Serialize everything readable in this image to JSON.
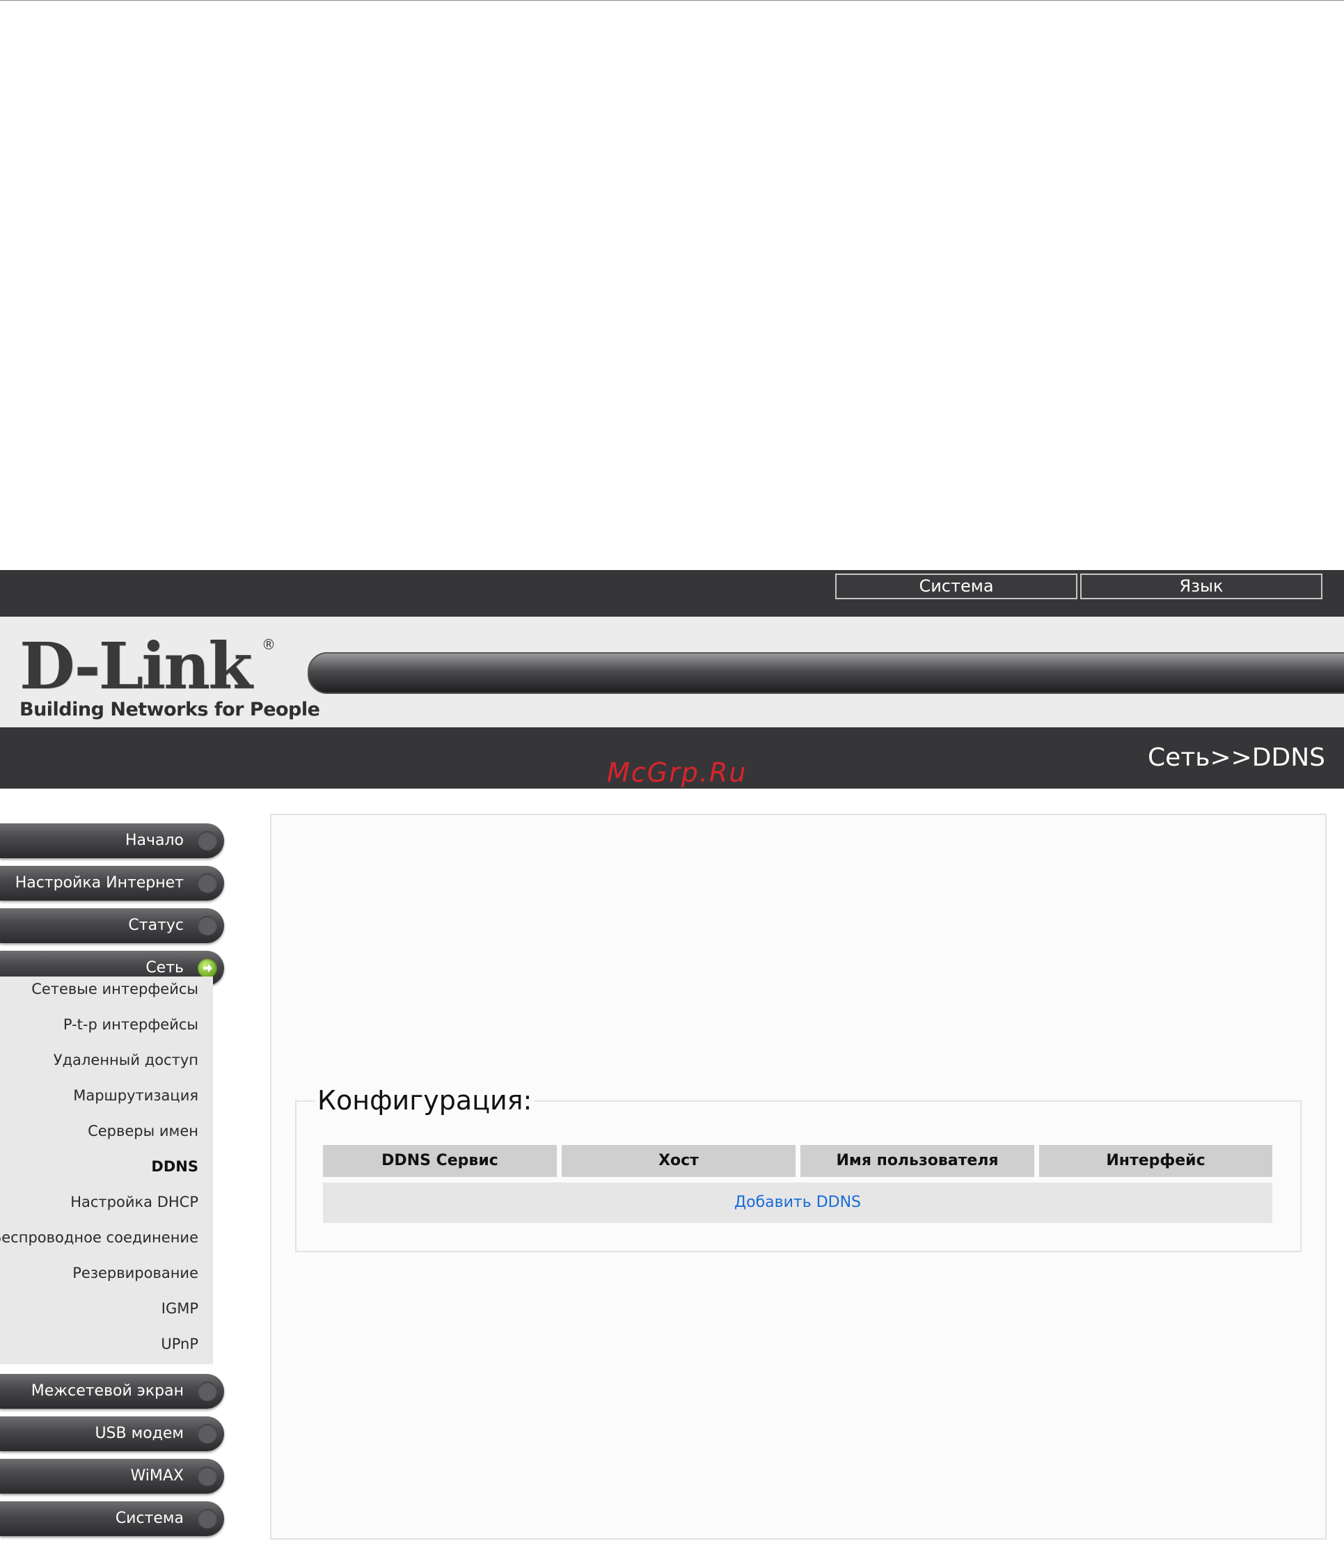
{
  "header": {
    "system_button": "Система",
    "language_button": "Язык"
  },
  "logo": {
    "brand": "D-Link",
    "registered": "®",
    "tagline": "Building Networks for People"
  },
  "breadcrumb": "Сеть>>DDNS",
  "watermark": "McGrp.Ru",
  "sidebar": {
    "menu": [
      {
        "label": "Начало"
      },
      {
        "label": "Настройка Интернет"
      },
      {
        "label": "Статус"
      },
      {
        "label": "Сеть",
        "active": true
      },
      {
        "label": "Межсетевой экран"
      },
      {
        "label": "USB модем"
      },
      {
        "label": "WiMAX"
      },
      {
        "label": "Система"
      }
    ],
    "submenu": [
      {
        "label": "Сетевые интерфейсы"
      },
      {
        "label": "P-t-p интерфейсы"
      },
      {
        "label": "Удаленный доступ"
      },
      {
        "label": "Маршрутизация"
      },
      {
        "label": "Серверы имен"
      },
      {
        "label": "DDNS",
        "current": true
      },
      {
        "label": "Настройка DHCP"
      },
      {
        "label": "Беспроводное соединение"
      },
      {
        "label": "Резервирование"
      },
      {
        "label": "IGMP"
      },
      {
        "label": "UPnP"
      }
    ]
  },
  "config": {
    "legend": "Конфигурация:",
    "columns": [
      "DDNS Сервис",
      "Хост",
      "Имя пользователя",
      "Интерфейс"
    ],
    "add_link": "Добавить DDNS"
  },
  "colors": {
    "dark_bar": "#363639",
    "active_icon": "#6aa620",
    "link": "#1a6bd6",
    "watermark": "#d8242b"
  },
  "icons": {
    "menu_arrow": "arrow-right-circle-icon"
  }
}
